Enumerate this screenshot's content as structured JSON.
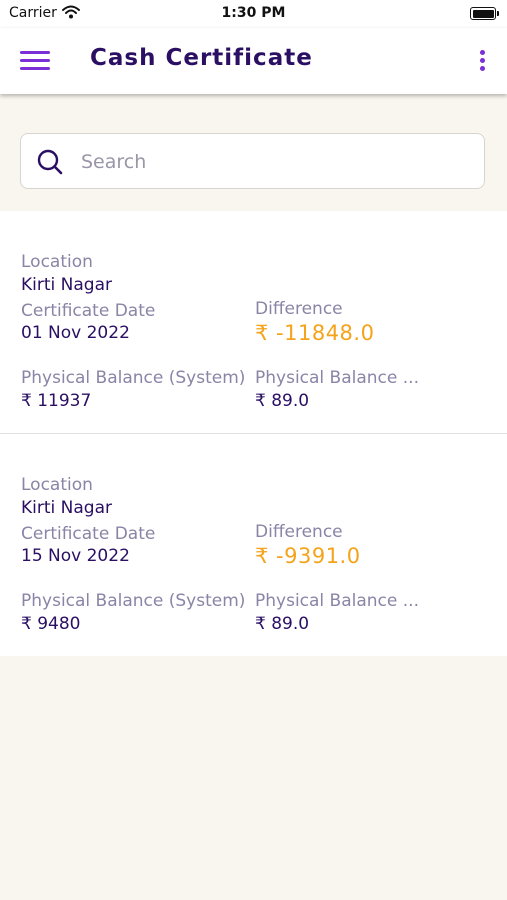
{
  "status_bar": {
    "carrier": "Carrier",
    "time": "1:30 PM"
  },
  "app_bar": {
    "title": "Cash Certificate",
    "menu_icon": "hamburger-menu-icon",
    "more_icon": "more-vertical-icon"
  },
  "search": {
    "placeholder": "Search",
    "value": "",
    "icon": "search-icon"
  },
  "colors": {
    "accent": "#7b2fd6",
    "title": "#2a0f63",
    "label": "#8a84a6",
    "difference": "#f5a31a",
    "background": "#f9f6ef"
  },
  "certificates": [
    {
      "location_label": "Location",
      "location": "Kirti Nagar",
      "date_label": "Certificate Date",
      "date": "01 Nov 2022",
      "difference_label": "Difference",
      "difference": "₹ -11848.0",
      "physical_system_label": "Physical Balance (System)",
      "physical_system": "₹ 11937",
      "physical_label": "Physical Balance ...",
      "physical": "₹ 89.0"
    },
    {
      "location_label": "Location",
      "location": "Kirti Nagar",
      "date_label": "Certificate Date",
      "date": "15 Nov 2022",
      "difference_label": "Difference",
      "difference": "₹ -9391.0",
      "physical_system_label": "Physical Balance (System)",
      "physical_system": "₹ 9480",
      "physical_label": "Physical Balance ...",
      "physical": "₹ 89.0"
    }
  ]
}
